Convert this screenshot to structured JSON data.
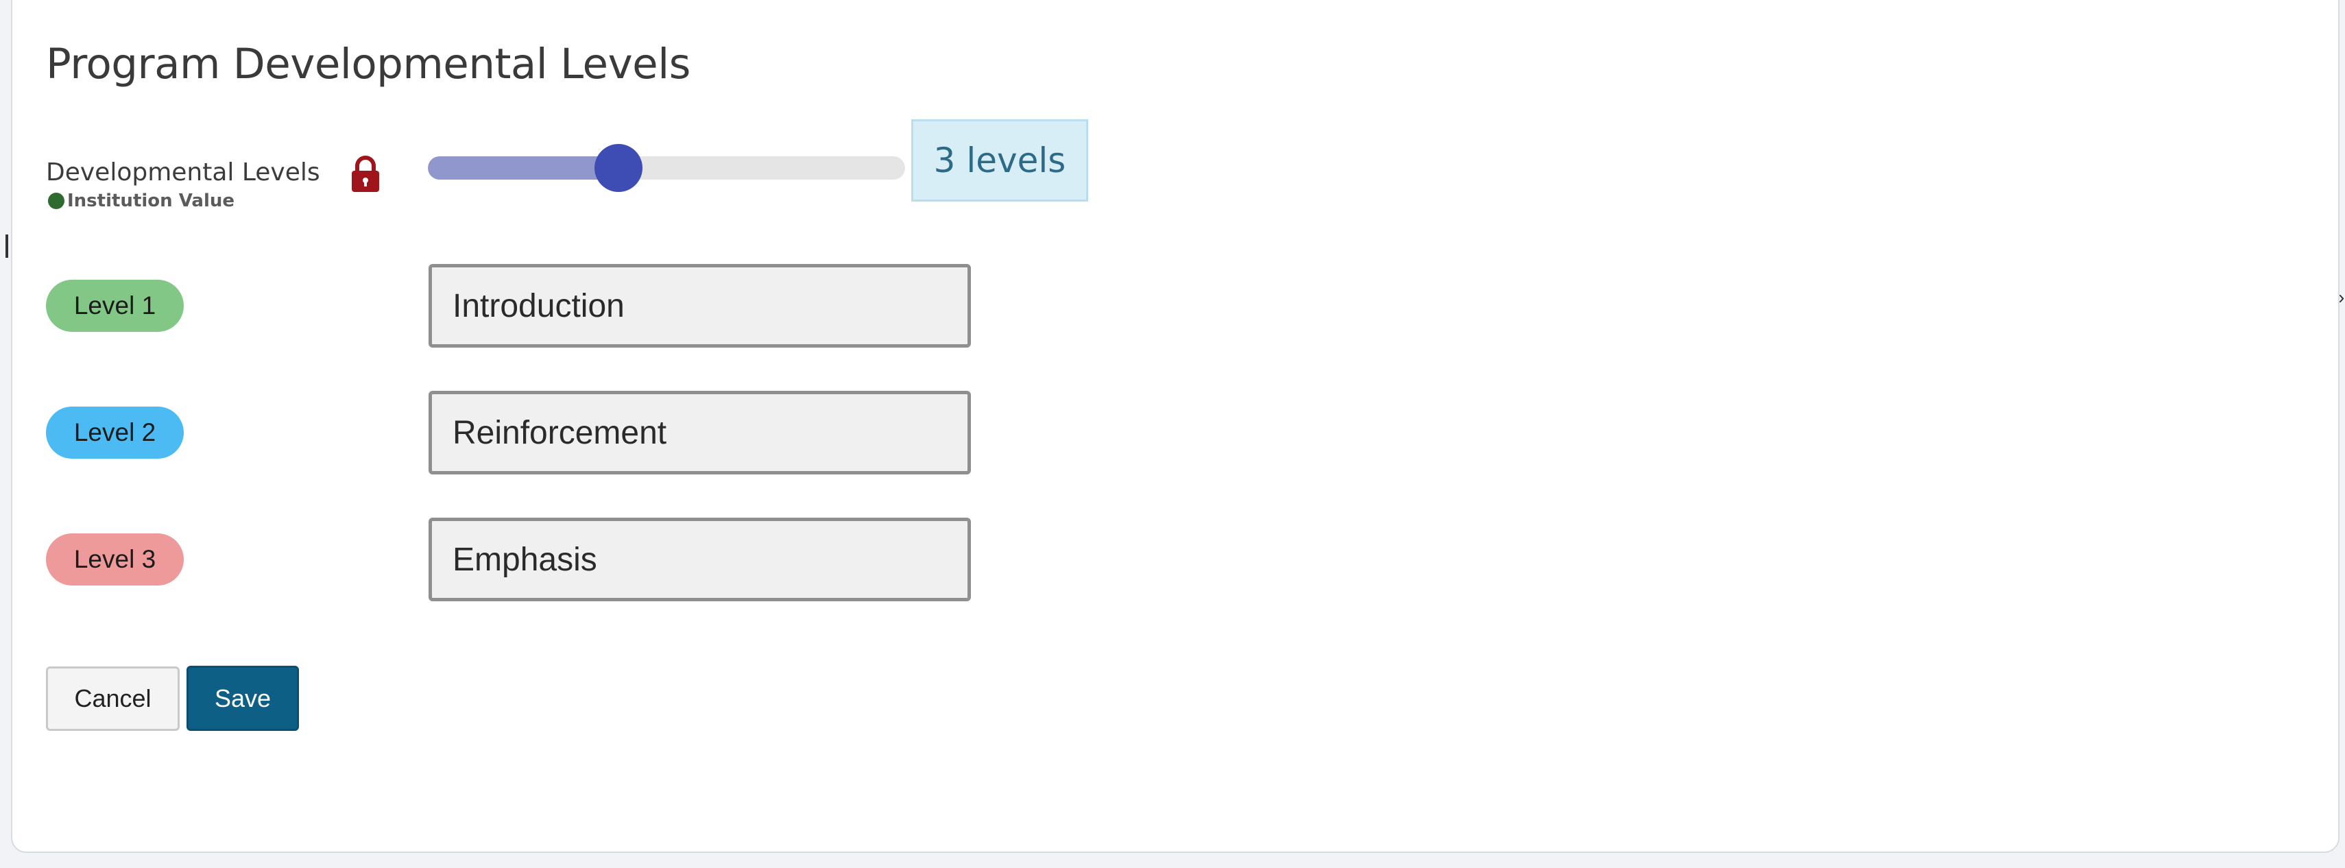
{
  "dialog": {
    "title": "Program Developmental Levels"
  },
  "developmental_levels": {
    "label": "Developmental Levels",
    "institution_value": "Institution Value",
    "lock_icon": "lock-icon",
    "slider": {
      "value": 3,
      "fill_fraction": 0.4
    },
    "levels_display": "3 levels"
  },
  "levels": [
    {
      "badge": "Level 1",
      "value": "Introduction",
      "color": "#82c785"
    },
    {
      "badge": "Level 2",
      "value": "Reinforcement",
      "color": "#4dbbf3"
    },
    {
      "badge": "Level 3",
      "value": "Emphasis",
      "color": "#ee9a9a"
    }
  ],
  "actions": {
    "cancel_label": "Cancel",
    "save_label": "Save"
  },
  "colors": {
    "accent": "#3e4db3",
    "save": "#0e5f86",
    "institution_dot": "#2f6a2e",
    "lock": "#a0141b"
  }
}
